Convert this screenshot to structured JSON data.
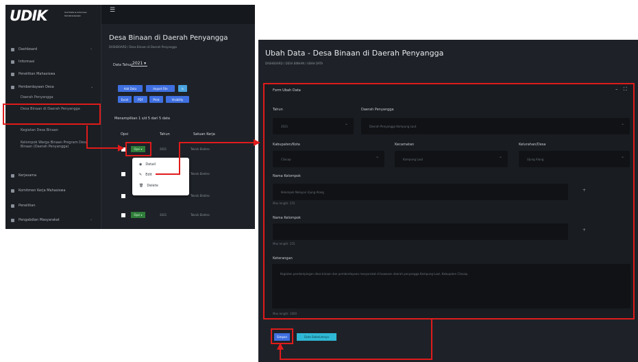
{
  "left": {
    "logo": {
      "text": "UDIK",
      "tagline": "Unit Data & Informasi Kemahasiswaan"
    },
    "sidebar": {
      "items": [
        {
          "label": "Dashboard",
          "caret": "‹"
        },
        {
          "label": "Informasi"
        },
        {
          "label": "Penelitian Mahasiswa"
        },
        {
          "label": "Pemberdayaan Desa",
          "caret": "⌄"
        }
      ],
      "sub_items": [
        "Daerah Penyangga",
        "Desa Binaan di Daerah Penyangga",
        "Kegiatan Desa Binaan",
        "Kelompok Warga Binaan Program Desa Binaan (Daerah Penyangga)"
      ],
      "bottom_items": [
        {
          "label": "Kerjasama"
        },
        {
          "label": "Komitmen Kerja Mahasiswa"
        },
        {
          "label": "Penelitian"
        },
        {
          "label": "Pengabdian Masyarakat",
          "caret": "‹"
        }
      ]
    },
    "page_title": "Desa Binaan di Daerah Penyangga",
    "breadcrumb": "DASHBOARD  /  Desa Binaan di Daerah Penyangga",
    "year_filter": {
      "label": "Data Tahun",
      "value": "2021 ▾"
    },
    "buttons": [
      {
        "label": "Add Data"
      },
      {
        "label": "Import File"
      },
      {
        "label": "Export"
      },
      {
        "label": "Excel"
      },
      {
        "label": "PDF"
      },
      {
        "label": "Print"
      },
      {
        "label": "Visibility"
      }
    ],
    "showing_text": "Menampilkan 1 s/d 5 dari 5 data",
    "table": {
      "headers": [
        "Opsi",
        "Tahun",
        "Satuan Kerja"
      ],
      "rows": [
        {
          "option": "Opsi ▾",
          "year": "2021",
          "unit": "Teknik Elektro"
        },
        {
          "option": "Opsi ▾",
          "year": "2021",
          "unit": "Teknik Elektro"
        },
        {
          "option": "Opsi ▾",
          "year": "2021",
          "unit": "Teknik Elektro"
        },
        {
          "option": "Opsi ▾",
          "year": "2021",
          "unit": "Teknik Elektro"
        }
      ]
    },
    "dropdown": [
      {
        "icon": "eye",
        "label": "Detail"
      },
      {
        "icon": "pencil",
        "label": "Edit"
      },
      {
        "icon": "trash",
        "label": "Delete"
      }
    ]
  },
  "right": {
    "page_title": "Ubah Data - Desa Binaan di Daerah Penyangga",
    "breadcrumb": "DASHBOARD  /  DESA BINAAN  /  UBAH DATA",
    "card_title": "Form Ubah Data",
    "card_tools": "– ⛶",
    "fields": {
      "tahun": {
        "label": "Tahun",
        "value": "2021"
      },
      "daerah": {
        "label": "Daerah Penyangga",
        "value": "Daerah Penyangga Kampung Laut"
      },
      "kabupaten": {
        "label": "Kabupaten/Kota",
        "value": "Cilacap"
      },
      "kecamatan": {
        "label": "Kecamatan",
        "value": "Kampung Laut"
      },
      "kelurahan": {
        "label": "Kelurahan/Desa",
        "value": "Ujung Alang"
      },
      "nama_kelompok": {
        "label": "Nama Kelompok",
        "value": "Kelompok Nelayan Ujung Alang",
        "hint": "Max length: 255"
      },
      "nama_kelompok_2": {
        "label": "Nama Kelompok",
        "value": "",
        "hint": "Max length: 255"
      },
      "keterangan": {
        "label": "Keterangan",
        "value": "Kegiatan pendampingan desa binaan dan pemberdayaan masyarakat di kawasan daerah penyangga Kampung Laut, Kabupaten Cilacap.",
        "hint": "Max length: 1000"
      }
    },
    "plus_symbol": "+",
    "buttons": {
      "save": "Simpan",
      "back": "Data Sebelumnya"
    }
  },
  "annotations": {
    "color": "#e01b1b"
  }
}
